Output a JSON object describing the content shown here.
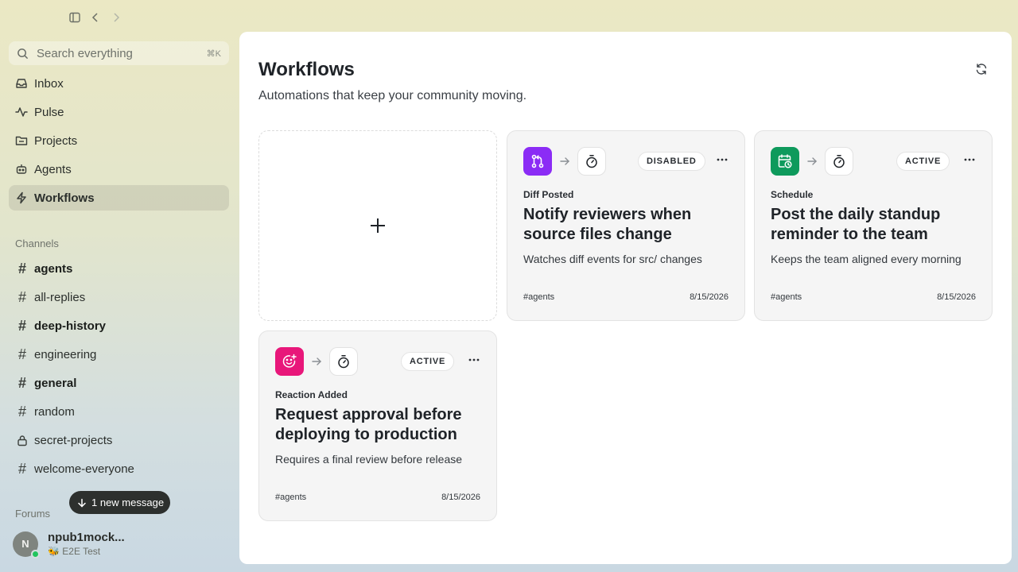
{
  "sidebar": {
    "search": {
      "placeholder": "Search everything",
      "shortcut": "⌘K"
    },
    "nav": [
      {
        "label": "Inbox",
        "icon": "inbox-icon"
      },
      {
        "label": "Pulse",
        "icon": "pulse-icon"
      },
      {
        "label": "Projects",
        "icon": "projects-icon"
      },
      {
        "label": "Agents",
        "icon": "agents-icon"
      },
      {
        "label": "Workflows",
        "icon": "workflows-icon",
        "active": true
      }
    ],
    "channels_label": "Channels",
    "channels": [
      {
        "name": "agents",
        "bold": true,
        "icon": "hash"
      },
      {
        "name": "all-replies",
        "bold": false,
        "icon": "hash"
      },
      {
        "name": "deep-history",
        "bold": true,
        "icon": "hash"
      },
      {
        "name": "engineering",
        "bold": false,
        "icon": "hash"
      },
      {
        "name": "general",
        "bold": true,
        "icon": "hash"
      },
      {
        "name": "random",
        "bold": false,
        "icon": "hash"
      },
      {
        "name": "secret-projects",
        "bold": false,
        "icon": "lock"
      },
      {
        "name": "welcome-everyone",
        "bold": false,
        "icon": "hash"
      }
    ],
    "forums_label": "Forums",
    "new_message_pill": "1 new message",
    "user": {
      "initial": "N",
      "name": "npub1mock...",
      "status": "🐝 E2E Test"
    }
  },
  "main": {
    "title": "Workflows",
    "subtitle": "Automations that keep your community moving.",
    "cards": [
      {
        "trigger_label": "Diff Posted",
        "title": "Notify reviewers when source files change",
        "description": "Watches diff events for src/ changes",
        "status": "DISABLED",
        "channel": "#agents",
        "date": "8/15/2026",
        "trigger_icon": "git-pull-request-icon",
        "trigger_color": "#8b2cf5"
      },
      {
        "trigger_label": "Schedule",
        "title": "Post the daily standup reminder to the team",
        "description": "Keeps the team aligned every morning",
        "status": "ACTIVE",
        "channel": "#agents",
        "date": "8/15/2026",
        "trigger_icon": "calendar-clock-icon",
        "trigger_color": "#0e9a5c"
      },
      {
        "trigger_label": "Reaction Added",
        "title": "Request approval before deploying to production",
        "description": "Requires a final review before release",
        "status": "ACTIVE",
        "channel": "#agents",
        "date": "8/15/2026",
        "trigger_icon": "smile-plus-icon",
        "trigger_color": "#e8177a"
      }
    ]
  }
}
